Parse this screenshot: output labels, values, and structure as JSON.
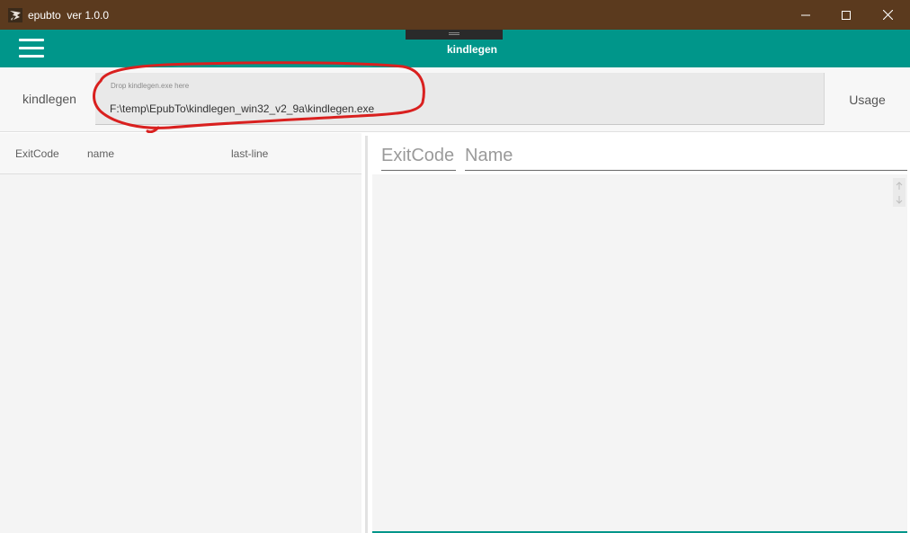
{
  "window": {
    "title": "epubto  ver 1.0.0",
    "icons": [
      "app-icon",
      "minimize-icon",
      "maximize-icon",
      "close-icon"
    ]
  },
  "header": {
    "title": "kindlegen",
    "menu_icon": "hamburger-menu-icon",
    "accent_color": "#00968a",
    "titlebar_color": "#5b3a1e"
  },
  "input_row": {
    "label": "kindlegen",
    "placeholder": "Drop kindlegen.exe here",
    "value": "F:\\temp\\EpubTo\\kindlegen_win32_v2_9a\\kindlegen.exe",
    "usage_button": "Usage"
  },
  "left_table": {
    "columns": [
      "ExitCode",
      "name",
      "last-line"
    ],
    "rows": []
  },
  "right_panel": {
    "exitcode_field": "ExitCode",
    "name_field": "Name",
    "scroll_icons": [
      "arrow-up-icon",
      "arrow-down-icon"
    ]
  },
  "annotation": {
    "color": "#d9201f"
  }
}
